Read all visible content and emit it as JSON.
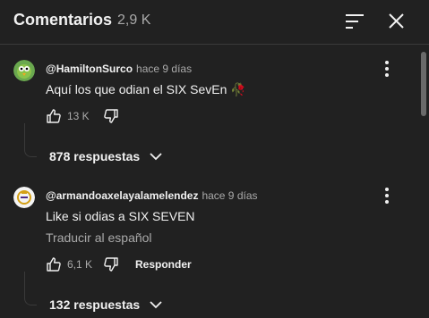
{
  "header": {
    "title": "Comentarios",
    "count": "2,9 K",
    "sort_icon": "sort-icon",
    "close_icon": "close-icon"
  },
  "comments": [
    {
      "author": "@HamiltonSurco",
      "time": "hace 9 días",
      "text": "Aquí los que odian el SIX SevEn 🥀",
      "likes": "13 K",
      "replies": "878 respuestas",
      "avatar_icon": "green-bird-avatar"
    },
    {
      "author": "@armandoaxelayalamelendez",
      "time": "hace 9 días",
      "text": "Like si odias a SIX SEVEN",
      "translate": "Traducir al español",
      "likes": "6,1 K",
      "reply_label": "Responder",
      "replies": "132 respuestas",
      "avatar_icon": "crest-avatar"
    }
  ],
  "colors": {
    "background": "#212121",
    "text": "#f1f1f1",
    "secondary_text": "#aaaaaa",
    "divider": "#3a3a3a"
  }
}
